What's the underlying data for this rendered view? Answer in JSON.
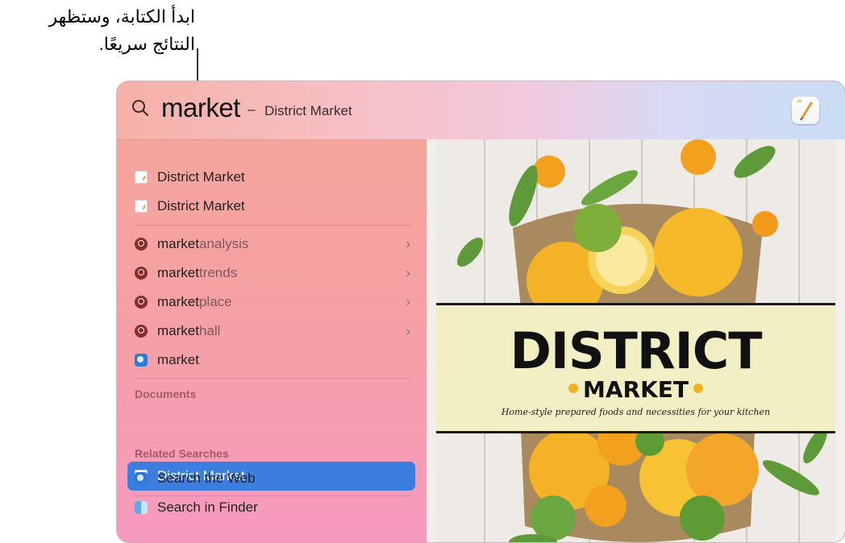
{
  "callout": {
    "line1": "ابدأ الكتابة، وستظهر",
    "line2": "النتائج سريعًا."
  },
  "search": {
    "query": "market",
    "dash": "–",
    "suggestion": "District Market"
  },
  "results": {
    "top_hits": [
      {
        "label": "District Market",
        "icon": "pages-document-icon"
      },
      {
        "label": "District Market",
        "icon": "pages-document-icon"
      }
    ],
    "suggestions": [
      {
        "typed": "market",
        "rest": " analysis",
        "icon": "search-suggestion-icon"
      },
      {
        "typed": "market",
        "rest": " trends",
        "icon": "search-suggestion-icon"
      },
      {
        "typed": "market",
        "rest": "place",
        "icon": "search-suggestion-icon"
      },
      {
        "typed": "market",
        "rest": " hall",
        "icon": "search-suggestion-icon"
      }
    ],
    "web": {
      "label": "market",
      "icon": "safari-icon"
    },
    "documents_header": "Documents",
    "documents": [
      {
        "label": "District Market",
        "icon": "pages-document-icon"
      }
    ],
    "related_header": "Related Searches",
    "related": [
      {
        "label": "Search the Web",
        "icon": "safari-icon"
      },
      {
        "label": "Search in Finder",
        "icon": "finder-icon"
      }
    ]
  },
  "preview": {
    "title": "DISTRICT",
    "subtitle": "MARKET",
    "tagline": "Home-style prepared foods and necessities for your kitchen"
  },
  "colors": {
    "selection": "#3c7ee0",
    "section_header": "#a35b66",
    "banner": "#f3efc4"
  }
}
